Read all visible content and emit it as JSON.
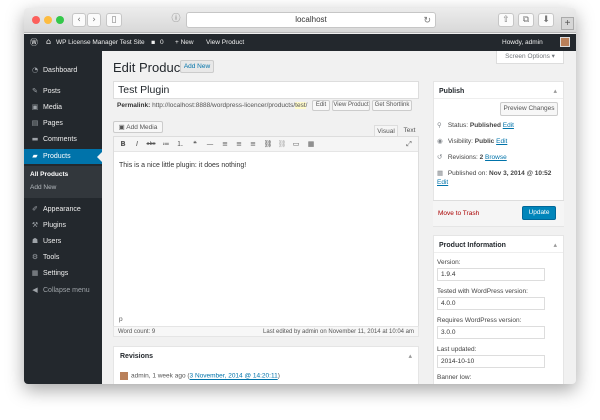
{
  "browser": {
    "url": "localhost",
    "new_tab_symbol": "+",
    "back_symbol": "‹",
    "forward_symbol": "›",
    "sidebar_symbol": "▯",
    "info_symbol": "ⓘ",
    "reload_symbol": "↻",
    "share_symbol": "⇧",
    "tabs_symbol": "⧉",
    "download_symbol": "⬇"
  },
  "adminbar": {
    "wp_icon": "Ⓦ",
    "site_icon": "⌂",
    "site_name": "WP License Manager Test Site",
    "comments_icon": "▪",
    "comments_count": "0",
    "new_label": "+ New",
    "view_product": "View Product",
    "greeting": "Howdy, admin"
  },
  "sidebar": {
    "items": [
      {
        "icon": "◔",
        "label": "Dashboard"
      },
      {
        "icon": "✎",
        "label": "Posts"
      },
      {
        "icon": "▣",
        "label": "Media"
      },
      {
        "icon": "▤",
        "label": "Pages"
      },
      {
        "icon": "▬",
        "label": "Comments"
      },
      {
        "icon": "▰",
        "label": "Products"
      },
      {
        "icon": "✐",
        "label": "Appearance"
      },
      {
        "icon": "⚒",
        "label": "Plugins"
      },
      {
        "icon": "☗",
        "label": "Users"
      },
      {
        "icon": "⚙",
        "label": "Tools"
      },
      {
        "icon": "▦",
        "label": "Settings"
      },
      {
        "icon": "◀",
        "label": "Collapse menu"
      }
    ],
    "submenu": [
      "All Products",
      "Add New"
    ]
  },
  "page": {
    "title": "Edit Product",
    "add_new": "Add New",
    "screen_options": "Screen Options ▾"
  },
  "editor": {
    "post_title": "Test Plugin",
    "permalink_label": "Permalink:",
    "permalink_base": "http://localhost:8888/wordpress-licencer/products/",
    "permalink_slug": "test",
    "permalink_end": "/",
    "edit_btn": "Edit",
    "view_product_btn": "View Product",
    "shortlink_btn": "Get Shortlink",
    "add_media": "Add Media",
    "tab_visual": "Visual",
    "tab_text": "Text",
    "toolbar": [
      "B",
      "I",
      "abc",
      "≔",
      "⒈",
      "❝",
      "—",
      "≡",
      "≡",
      "≡",
      "⛓",
      "⛓",
      "▭",
      "▦",
      "⤢"
    ],
    "content": "This is a nice little plugin: it does nothing!",
    "path": "p",
    "word_count": "Word count: 9",
    "last_edited": "Last edited by admin on November 11, 2014 at 10:04 am"
  },
  "revisions": {
    "heading": "Revisions",
    "toggle": "▴",
    "entry_prefix": "admin, 1 week ago (",
    "entry_link": "3 November, 2014 @ 14:20:11",
    "entry_suffix": ")"
  },
  "publish": {
    "heading": "Publish",
    "toggle": "▴",
    "preview": "Preview Changes",
    "status_icon": "📌",
    "status_label": "Status:",
    "status_value": "Published",
    "status_edit": "Edit",
    "visibility_icon": "👁",
    "visibility_label": "Visibility:",
    "visibility_value": "Public",
    "visibility_edit": "Edit",
    "revisions_icon": "↺",
    "revisions_label": "Revisions:",
    "revisions_value": "2",
    "revisions_browse": "Browse",
    "published_icon": "▦",
    "published_label": "Published on:",
    "published_value": "Nov 3, 2014 @ 10:52",
    "published_edit": "Edit",
    "trash": "Move to Trash",
    "update": "Update"
  },
  "product_info": {
    "heading": "Product Information",
    "toggle": "▴",
    "fields": [
      {
        "label": "Version:",
        "value": "1.9.4"
      },
      {
        "label": "Tested with WordPress version:",
        "value": "4.0.0"
      },
      {
        "label": "Requires WordPress version:",
        "value": "3.0.0"
      },
      {
        "label": "Last updated:",
        "value": "2014-10-10"
      }
    ],
    "next_label": "Banner low:"
  }
}
